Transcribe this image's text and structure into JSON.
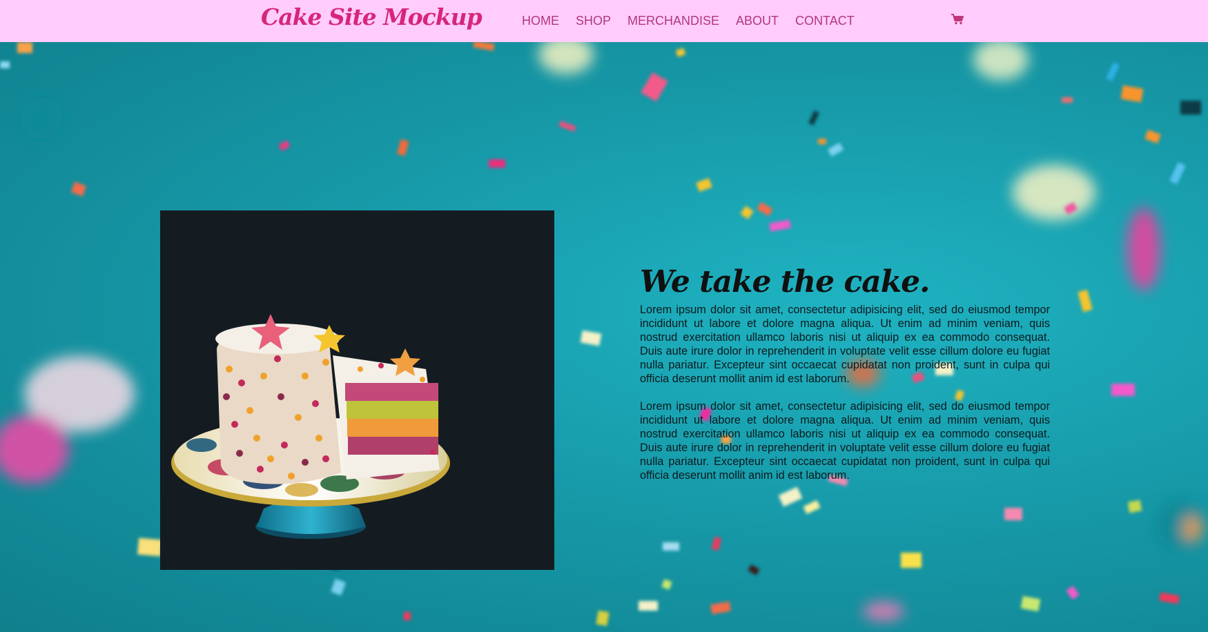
{
  "navbar": {
    "brand": "Cake Site Mockup",
    "items": [
      {
        "label": "HOME"
      },
      {
        "label": "SHOP"
      },
      {
        "label": "MERCHANDISE"
      },
      {
        "label": "ABOUT"
      },
      {
        "label": "CONTACT"
      }
    ],
    "cart_icon": "shopping-cart-icon"
  },
  "hero": {
    "image_subject": "layer cake on cake stand",
    "headline": "We take the cake.",
    "paragraphs": [
      "Lorem ipsum dolor sit amet, consectetur adipisicing elit, sed do eiusmod tempor incididunt ut labore et dolore magna aliqua. Ut enim ad minim veniam, quis nostrud exercitation ullamco laboris nisi ut aliquip ex ea commodo consequat. Duis aute irure dolor in reprehenderit in voluptate velit esse cillum dolore eu fugiat nulla pariatur. Excepteur sint occaecat cupidatat non proident, sunt in culpa qui officia deserunt mollit anim id est laborum.",
      "Lorem ipsum dolor sit amet, consectetur adipisicing elit, sed do eiusmod tempor incididunt ut labore et dolore magna aliqua. Ut enim ad minim veniam, quis nostrud exercitation ullamco laboris nisi ut aliquip ex ea commodo consequat. Duis aute irure dolor in reprehenderit in voluptate velit esse cillum dolore eu fugiat nulla pariatur. Excepteur sint occaecat cupidatat non proident, sunt in culpa qui officia deserunt mollit anim id est laborum."
    ]
  },
  "colors": {
    "navbar_bg": "#ffccfb",
    "brand": "#d6267a",
    "nav_link": "#b0377c",
    "hero_bg": "#1a9aa8",
    "photo_bg": "#141c22"
  }
}
